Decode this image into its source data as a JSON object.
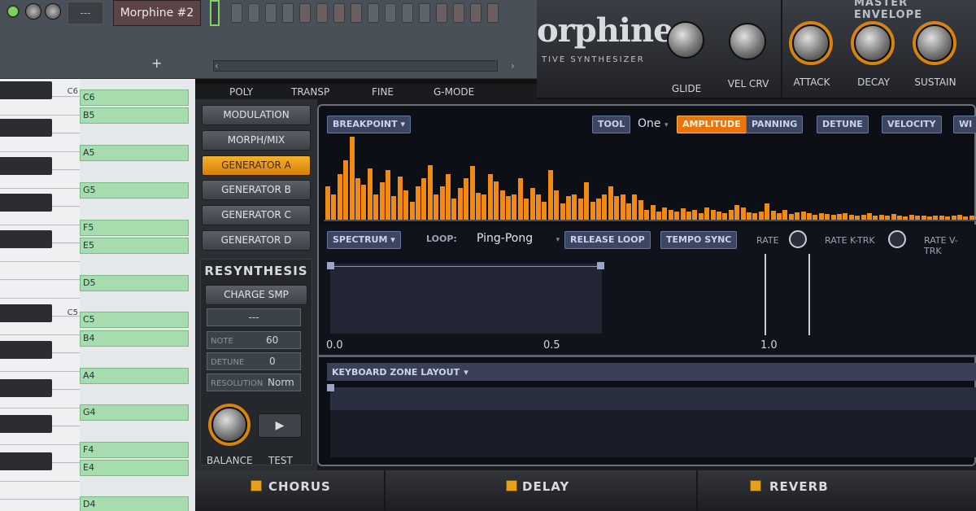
{
  "daw": {
    "menu_value": "---",
    "instrument_name": "Morphine #2",
    "add_symbol": "+",
    "pattern_steps": 16
  },
  "plugin": {
    "logo_big": "orphine",
    "logo_small": "TIVE SYNTHESIZER",
    "master_envelope_title": "MASTER ENVELOPE",
    "small_labels": [
      "POLY",
      "TRANSP",
      "FINE",
      "G-MODE"
    ],
    "knobs": [
      {
        "label": "GLIDE"
      },
      {
        "label": "VEL CRV"
      },
      {
        "label": "ATTACK"
      },
      {
        "label": "DECAY"
      },
      {
        "label": "SUSTAIN"
      }
    ],
    "nav_buttons": [
      "MODULATION",
      "MORPH/MIX",
      "GENERATOR A",
      "GENERATOR B",
      "GENERATOR C",
      "GENERATOR D"
    ],
    "resynthesis": {
      "title": "RESYNTHESIS",
      "charge_button": "CHARGE SMP",
      "sample_value": "---",
      "note_label": "NOTE",
      "note_value": "60",
      "detune_label": "DETUNE",
      "detune_value": "0",
      "resolution_label": "RESOLUTION",
      "resolution_value": "Norm",
      "balance_label": "BALANCE",
      "test_label": "TEST"
    }
  },
  "editor": {
    "breakpoint_label": "BREAKPOINT",
    "tool_label": "TOOL",
    "tool_value": "One",
    "tabs": [
      "AMPLITUDE",
      "PANNING",
      "DETUNE",
      "VELOCITY",
      "WI"
    ],
    "spectrum_label": "SPECTRUM",
    "loop_label": "LOOP:",
    "loop_value": "Ping-Pong",
    "release_loop": "RELEASE LOOP",
    "tempo_sync": "TEMPO SYNC",
    "rate_label": "RATE",
    "rate_ktrk_label": "RATE K-TRK",
    "rate_vtrk_label": "RATE V-TRK",
    "ticks": [
      "0.0",
      "0.5",
      "1.0"
    ],
    "keyboard_zone_label": "KEYBOARD ZONE LAYOUT",
    "amplitudes": [
      0.4,
      0.3,
      0.55,
      0.72,
      1.0,
      0.5,
      0.42,
      0.62,
      0.3,
      0.45,
      0.6,
      0.28,
      0.52,
      0.35,
      0.22,
      0.4,
      0.5,
      0.66,
      0.3,
      0.4,
      0.55,
      0.25,
      0.38,
      0.5,
      0.65,
      0.32,
      0.3,
      0.55,
      0.46,
      0.35,
      0.28,
      0.3,
      0.5,
      0.25,
      0.38,
      0.3,
      0.22,
      0.6,
      0.35,
      0.2,
      0.28,
      0.3,
      0.25,
      0.45,
      0.22,
      0.25,
      0.3,
      0.4,
      0.28,
      0.3,
      0.2,
      0.3,
      0.24,
      0.12,
      0.18,
      0.1,
      0.15,
      0.12,
      0.1,
      0.14,
      0.1,
      0.12,
      0.08,
      0.15,
      0.12,
      0.1,
      0.08,
      0.12,
      0.18,
      0.15,
      0.09,
      0.08,
      0.1,
      0.2,
      0.11,
      0.08,
      0.12,
      0.07,
      0.09,
      0.1,
      0.08,
      0.06,
      0.08,
      0.07,
      0.06,
      0.07,
      0.08,
      0.06,
      0.05,
      0.06,
      0.08,
      0.05,
      0.06,
      0.05,
      0.07,
      0.05,
      0.04,
      0.06,
      0.05,
      0.05,
      0.04,
      0.05,
      0.05,
      0.04,
      0.05,
      0.06,
      0.04,
      0.05,
      0.04,
      0.05
    ]
  },
  "piano": {
    "octave_c6": "C6",
    "octave_c5": "C5",
    "rows": [
      "C6",
      "B5",
      "A5",
      "G5",
      "F5",
      "E5",
      "D5",
      "C5",
      "B4",
      "A4",
      "G4",
      "F4",
      "E4",
      "D4"
    ]
  },
  "effects": [
    "CHORUS",
    "DELAY",
    "REVERB"
  ]
}
